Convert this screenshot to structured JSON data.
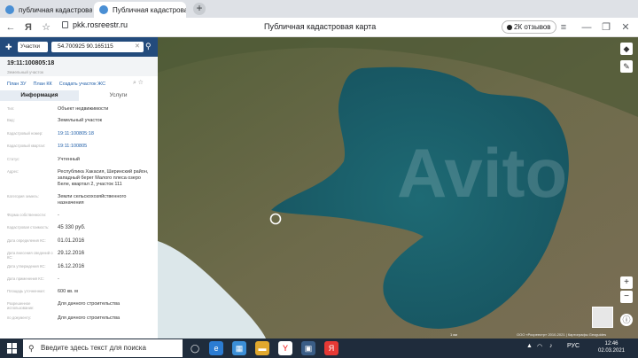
{
  "browser": {
    "tabs": [
      {
        "label": "публичная кадастровая карта"
      },
      {
        "label": "Публичная кадастровая карта"
      }
    ],
    "new_tab": "+",
    "url": "pkk.rosreestr.ru",
    "page_title": "Публичная кадастровая карта",
    "reviews_badge": "2К отзывов"
  },
  "panel": {
    "search_type": "Участки",
    "search_value": "54.700925 90.165115",
    "object_number": "19:11:100805:18",
    "object_subtitle": "Земельный участок",
    "links": [
      "План ЗУ",
      "План КК",
      "Создать участок ЖС"
    ],
    "tabs": [
      {
        "label": "Информация"
      },
      {
        "label": "Услуги"
      }
    ],
    "rows": [
      {
        "key": "Тип:",
        "value": "Объект недвижимости"
      },
      {
        "key": "Вид:",
        "value": "Земельный участок"
      },
      {
        "key": "Кадастровый номер:",
        "value": "19:11:100805:18"
      },
      {
        "key": "Кадастровый квартал:",
        "value": "19:11:100805"
      },
      {
        "key": "Статус:",
        "value": "Учтенный"
      },
      {
        "key": "Адрес:",
        "value": "Республика Хакасия, Ширинский район, западный берег Малого плеса озеро Беле, квартал 2, участок 111"
      },
      {
        "key": "Категория земель:",
        "value": "Земли сельскохозяйственного назначения"
      },
      {
        "key": "Форма собственности:",
        "value": "-"
      },
      {
        "key": "Кадастровая стоимость:",
        "value": "45 330 руб."
      },
      {
        "key": "Дата определения КС:",
        "value": "01.01.2016"
      },
      {
        "key": "Дата внесения сведений о КС:",
        "value": "29.12.2016"
      },
      {
        "key": "Дата утверждения КС:",
        "value": "16.12.2016"
      },
      {
        "key": "Дата применения КС:",
        "value": "-"
      },
      {
        "key": "Площадь уточненная:",
        "value": "600 кв. м"
      },
      {
        "key": "Разрешенное использование:",
        "value": "Для дачного строительства"
      },
      {
        "key": "по документу:",
        "value": "Для дачного строительства"
      }
    ]
  },
  "map": {
    "zoom_in": "+",
    "zoom_out": "−",
    "scale_label": "1 км",
    "attribution": "ООО «Росреестр» 2010-2021 | Картографы Geoguides",
    "watermark": "Avito"
  },
  "taskbar": {
    "search_placeholder": "Введите здесь текст для поиска",
    "language": "РУС",
    "time": "12:46",
    "date": "02.03.2021"
  },
  "colors": {
    "panel_header": "#234b7c",
    "link": "#1f5ea8",
    "lake": "#1d5f6a",
    "snow": "#dce7ea",
    "taskbar": "#1f2c3c"
  }
}
